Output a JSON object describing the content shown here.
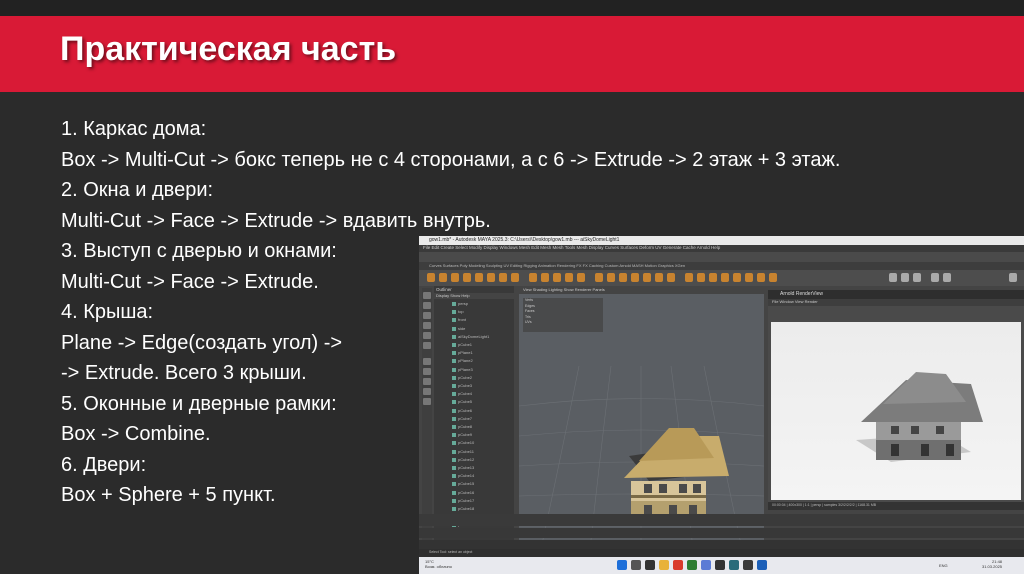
{
  "slide": {
    "title": "Практическая часть",
    "steps": [
      "1. Каркас дома:",
      "Box -> Multi-Cut -> бокс теперь не с 4 сторонами, а с 6 -> Extrude -> 2 этаж + 3 этаж.",
      "2. Окна и двери:",
      "Multi-Cut -> Face -> Extrude -> вдавить внутрь.",
      "3. Выступ с дверью и окнами:",
      "Multi-Cut -> Face -> Extrude.",
      "4. Крыша:",
      "Plane -> Edge(создать угол) ->",
      "-> Extrude. Всего 3 крыши.",
      "5. Оконные и дверные рамки:",
      "Box -> Combine.",
      "6. Двери:",
      "Box + Sphere + 5 пункт."
    ]
  },
  "screenshot": {
    "window_title": "gow1.mb* - Autodesk MAYA 2025.3: C:\\Users\\\\Desktop\\gow1.mb --- aiSkyDomeLight1",
    "menu": "File  Edit  Create  Select  Modify  Display  Windows  Mesh  Edit Mesh  Mesh Tools  Mesh Display  Curves  Surfaces  Deform  UV  Generate  Cache  Arnold  Help",
    "shelf_tabs": "Curves  Surfaces  Poly Modeling  Sculpting  UV Editing  Rigging  Animation  Rendering  FX  FX Caching  Custom  Arnold  MASH  Motion Graphics  XGen",
    "outliner_title": "Outliner",
    "outliner_menu": "Display  Show  Help",
    "outliner_items": [
      "persp",
      "top",
      "front",
      "side",
      "aiSkyDomeLight1",
      "pCube1",
      "pPlane1",
      "pPlane2",
      "pPlane3",
      "pCube2",
      "pCube3",
      "pCube4",
      "pCube5",
      "pCube6",
      "pCube7",
      "pCube8",
      "pCube9",
      "pCube10",
      "pCube11",
      "pCube12",
      "pCube13",
      "pCube14",
      "pCube15",
      "pCube16",
      "pCube17",
      "pCube18",
      "pCube19",
      "pCube20",
      "pCube21",
      "pCube22"
    ],
    "viewport_menu": "View  Shading  Lighting  Show  Renderer  Panels",
    "viewport_stats": [
      "Verts",
      "Edges",
      "Faces",
      "Tris",
      "UVs"
    ],
    "viewport_label": "persp",
    "render_view_title": "Arnold RenderView",
    "render_view_menu": "File  Window  View  Render",
    "render_status": "00:00:04 | 400x300 | 1:1 | persp | samples 3/2/2/2/2/2 | 1168.31 MB",
    "help_line": "Select Tool: select an object",
    "weather": {
      "temp": "15°C",
      "desc": "Возм. облачно"
    },
    "lang": "ENG",
    "time": "21:48",
    "date": "31.03.2025"
  }
}
